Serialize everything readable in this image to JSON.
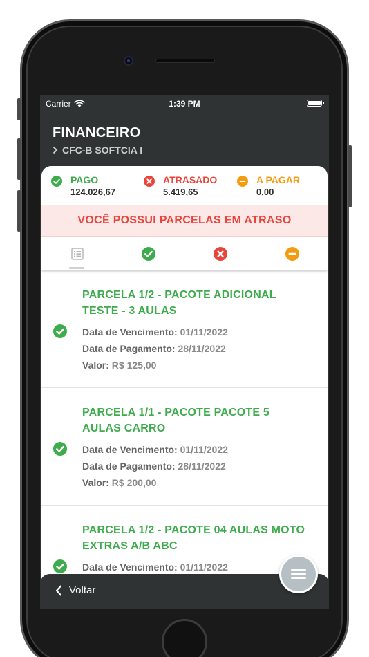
{
  "status_bar": {
    "carrier": "Carrier",
    "time": "1:39 PM"
  },
  "header": {
    "title": "FINANCEIRO",
    "breadcrumb": "CFC-B SOFTCIA I"
  },
  "summary": {
    "paid": {
      "label": "PAGO",
      "value": "124.026,67",
      "color": "#3eac4c"
    },
    "late": {
      "label": "ATRASADO",
      "value": "5.419,65",
      "color": "#e8443a"
    },
    "to_pay": {
      "label": "A PAGAR",
      "value": "0,00",
      "color": "#f39c12"
    }
  },
  "alert": {
    "message": "VOCÊ POSSUI PARCELAS EM ATRASO"
  },
  "tabs": [
    {
      "icon": "list-icon",
      "selected": true
    },
    {
      "icon": "check-circle-icon",
      "color": "#3eac4c"
    },
    {
      "icon": "x-circle-icon",
      "color": "#e8443a"
    },
    {
      "icon": "minus-circle-icon",
      "color": "#f39c12"
    }
  ],
  "labels": {
    "due_date": "Data de Vencimento:",
    "payment_date": "Data de Pagamento:",
    "value": "Valor:"
  },
  "parcelas": [
    {
      "title": "PARCELA 1/2 - PACOTE ADICIONAL TESTE - 3 AULAS",
      "due_date": "01/11/2022",
      "payment_date": "28/11/2022",
      "value": "R$ 125,00",
      "status": "paid"
    },
    {
      "title": "PARCELA 1/1 - PACOTE PACOTE 5 AULAS CARRO",
      "due_date": "01/11/2022",
      "payment_date": "28/11/2022",
      "value": "R$ 200,00",
      "status": "paid"
    },
    {
      "title": "PARCELA 1/2 - PACOTE 04 AULAS MOTO EXTRAS A/B ABC",
      "due_date": "01/11/2022",
      "status": "paid"
    }
  ],
  "footer": {
    "back_label": "Voltar"
  }
}
